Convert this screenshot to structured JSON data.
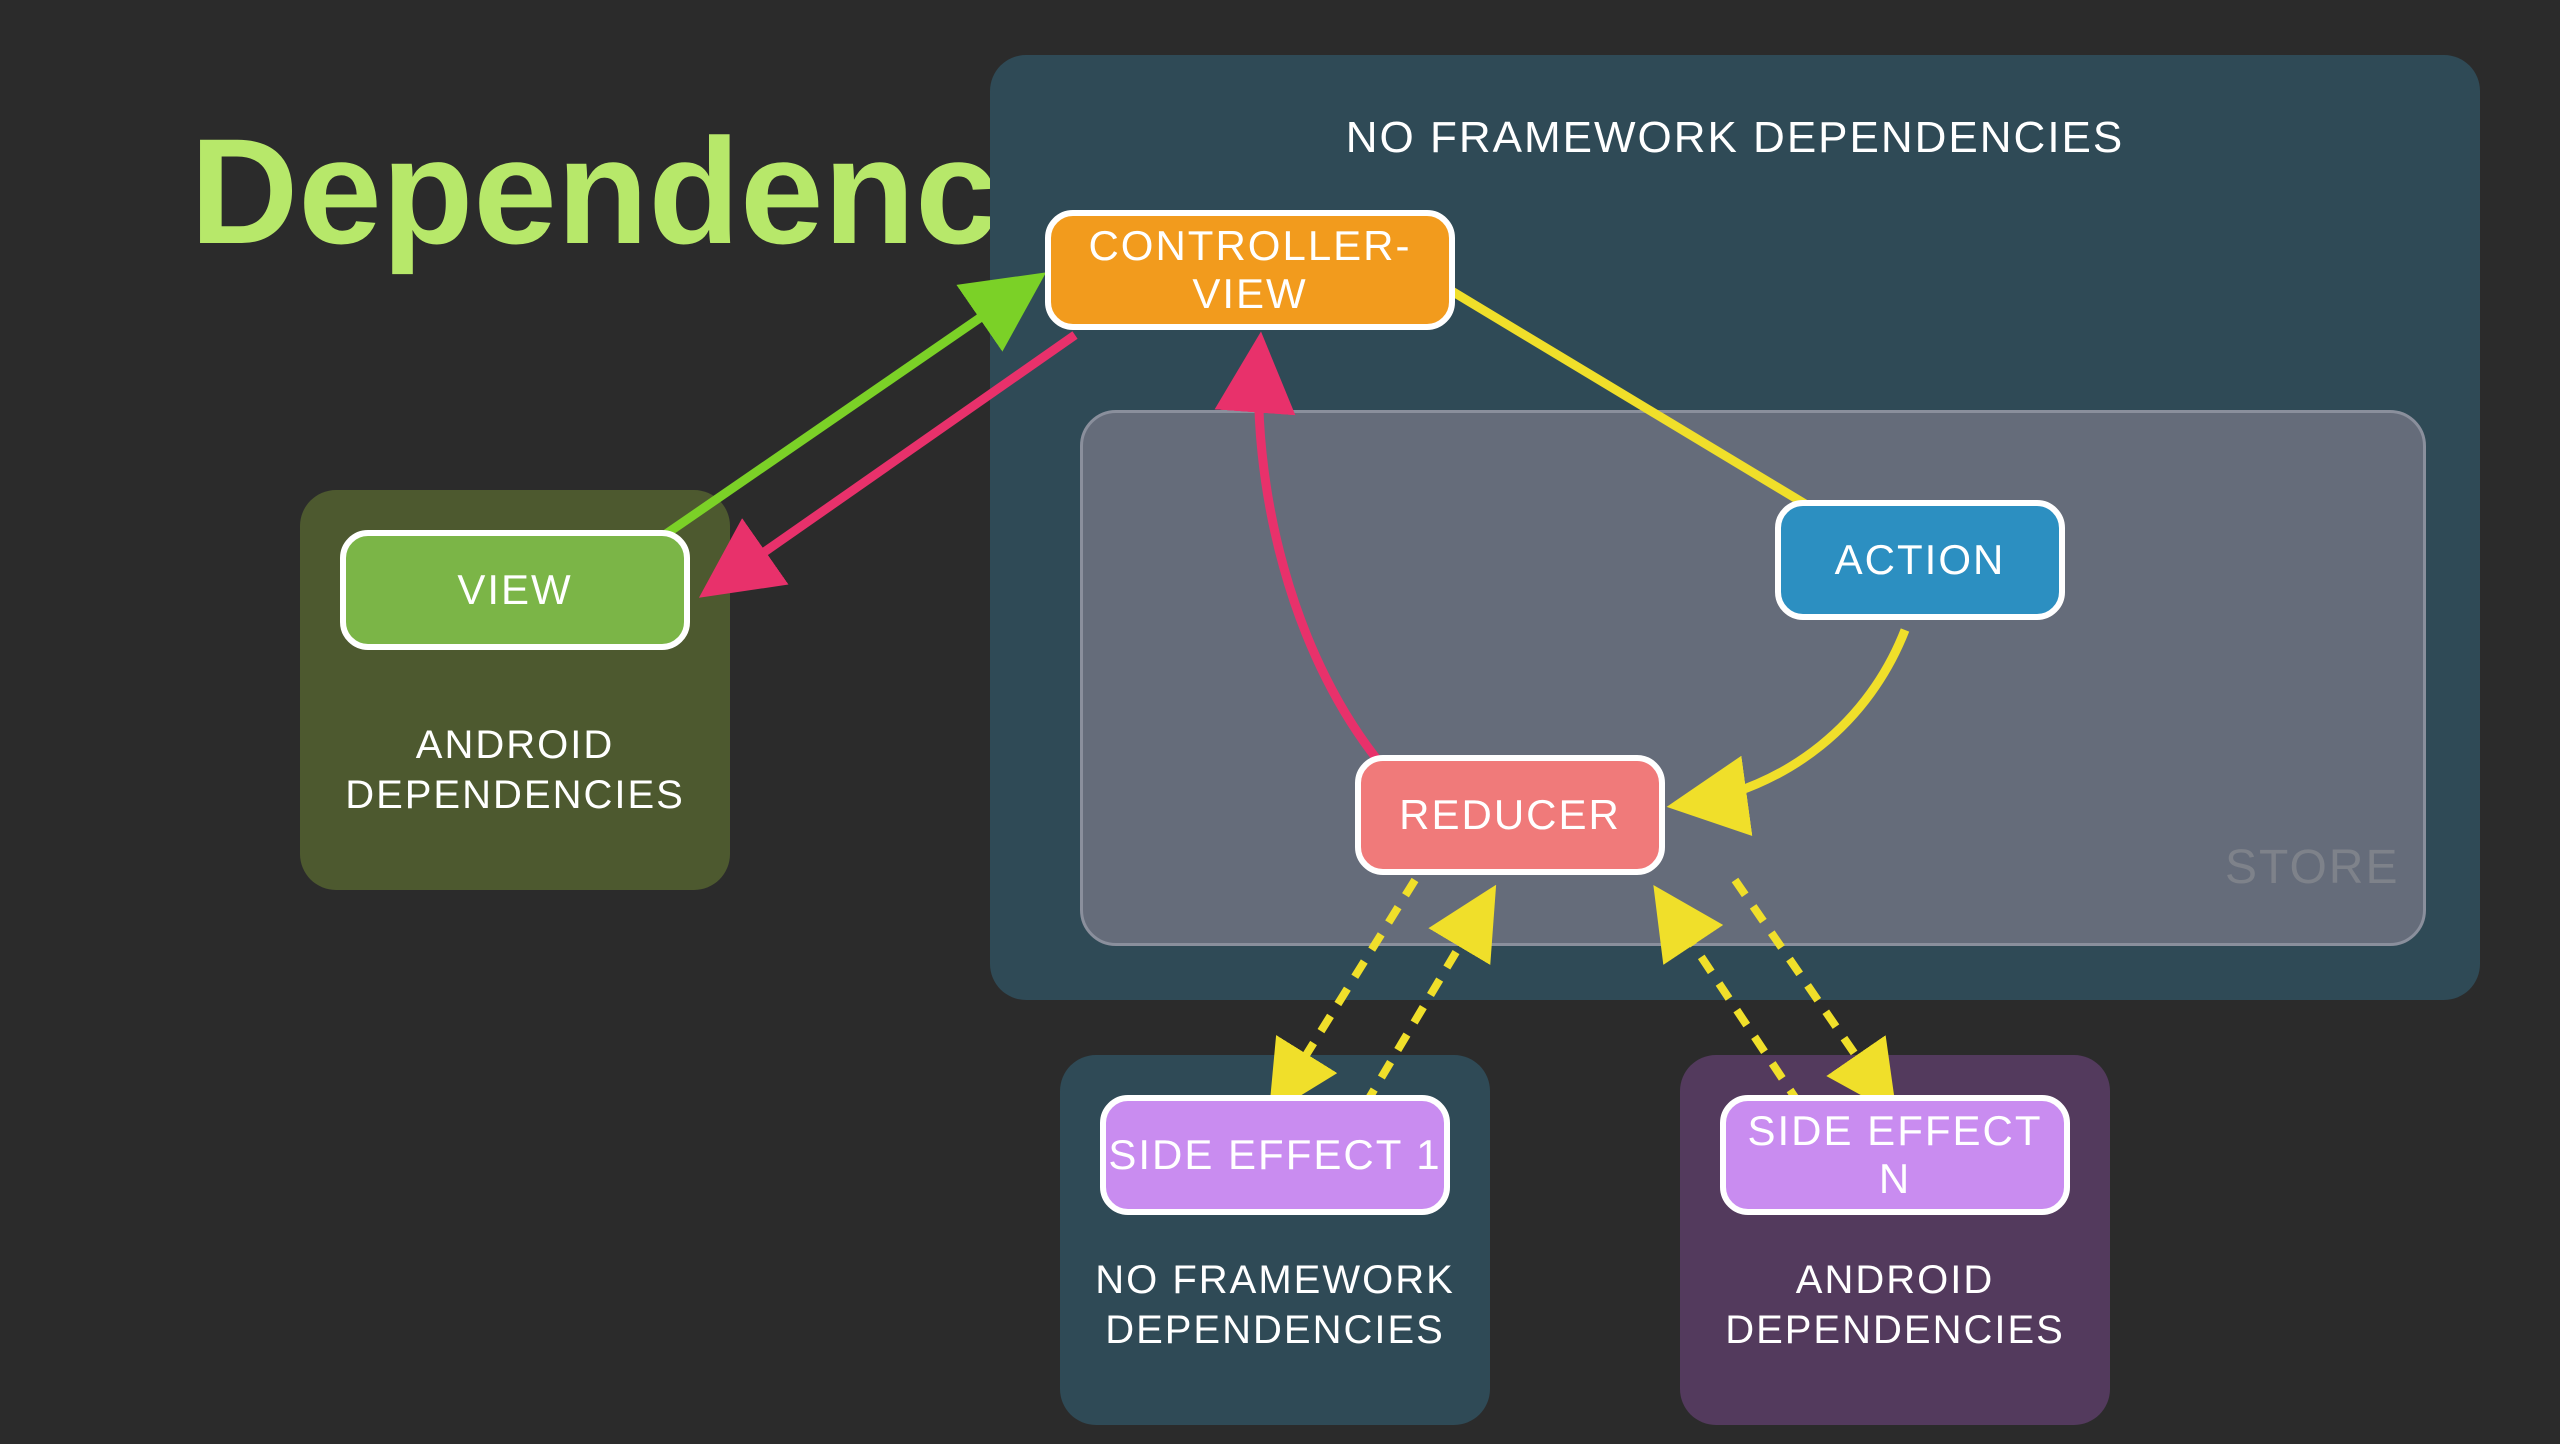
{
  "title": {
    "text": "Dependencies",
    "color": "#b7e86a"
  },
  "colors": {
    "bg": "#2b2b2b",
    "panel_dark_teal": "#2f4a56",
    "panel_olive": "#4d592f",
    "panel_slate": "#6e7280",
    "panel_purple": "#533a5d",
    "node_green": "#7bb547",
    "node_orange": "#f29b1d",
    "node_blue": "#2c8fc1",
    "node_salmon": "#f07a7a",
    "node_lilac": "#c98cf0",
    "arrow_green": "#7bd127",
    "arrow_pink": "#e8316b",
    "arrow_yellow": "#f0df2a"
  },
  "panels": {
    "main": {
      "label": "NO FRAMEWORK DEPENDENCIES"
    },
    "view_panel": {
      "caption": "ANDROID\nDEPENDENCIES"
    },
    "store": {
      "label": "STORE"
    },
    "side1_panel": {
      "caption": "NO FRAMEWORK\nDEPENDENCIES"
    },
    "siden_panel": {
      "caption": "ANDROID\nDEPENDENCIES"
    }
  },
  "nodes": {
    "view": "VIEW",
    "controller_view": "CONTROLLER-VIEW",
    "action": "ACTION",
    "reducer": "REDUCER",
    "side_effect_1": "SIDE EFFECT 1",
    "side_effect_n": "SIDE EFFECT N"
  }
}
